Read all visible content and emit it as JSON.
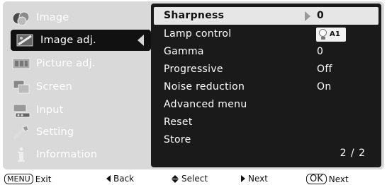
{
  "sidebar": {
    "items": [
      {
        "label": "Image",
        "icon": "image-icon"
      },
      {
        "label": "Image adj.",
        "icon": "image-adj-icon",
        "active": true
      },
      {
        "label": "Picture adj.",
        "icon": "picture-adj-icon"
      },
      {
        "label": "Screen",
        "icon": "screen-icon"
      },
      {
        "label": "Input",
        "icon": "input-icon"
      },
      {
        "label": "Setting",
        "icon": "setting-icon"
      },
      {
        "label": "Information",
        "icon": "information-icon"
      }
    ]
  },
  "panel": {
    "rows": [
      {
        "label": "Sharpness",
        "value": "0",
        "selected": true
      },
      {
        "label": "Lamp control",
        "value": "A1",
        "icon": "lamp-icon"
      },
      {
        "label": "Gamma",
        "value": "0"
      },
      {
        "label": "Progressive",
        "value": "Off"
      },
      {
        "label": "Noise reduction",
        "value": "On"
      },
      {
        "label": "Advanced menu",
        "value": ""
      },
      {
        "label": "Reset",
        "value": ""
      },
      {
        "label": "Store",
        "value": ""
      }
    ],
    "page": "2 / 2"
  },
  "help": {
    "menu_key": "MENU",
    "exit": "Exit",
    "back": "Back",
    "select": "Select",
    "next": "Next",
    "ok_key": "OK",
    "ok_next": "Next"
  },
  "colors": {
    "background": "#d9d9d9",
    "panel": "#1a1a1a",
    "selected_row": "#e6e6e6",
    "active_item": "#111111"
  }
}
